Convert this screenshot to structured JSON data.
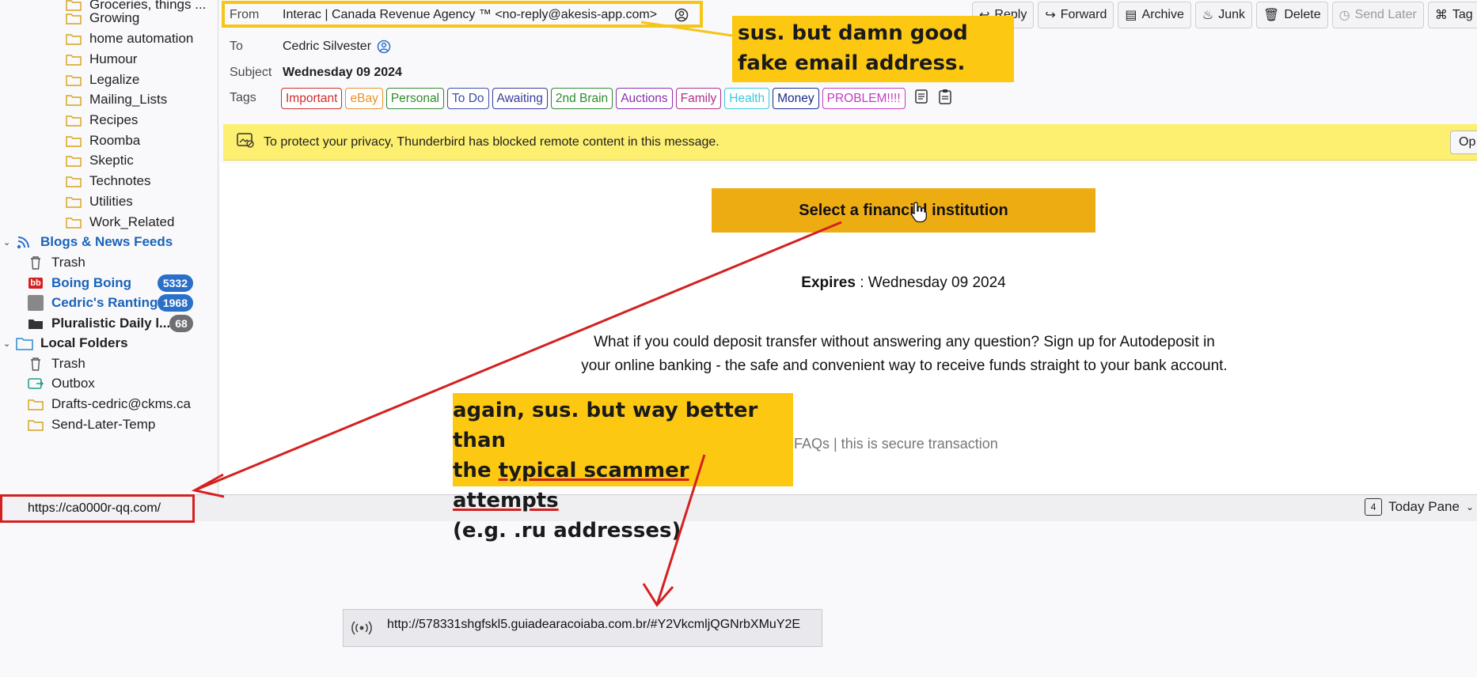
{
  "sidebar": {
    "folders_top": [
      {
        "label": "Groceries, things ..."
      },
      {
        "label": "Growing"
      },
      {
        "label": "home automation"
      },
      {
        "label": "Humour"
      },
      {
        "label": "Legalize"
      },
      {
        "label": "Mailing_Lists"
      },
      {
        "label": "Recipes"
      },
      {
        "label": "Roomba"
      },
      {
        "label": "Skeptic"
      },
      {
        "label": "Technotes"
      },
      {
        "label": "Utilities"
      },
      {
        "label": "Work_Related"
      }
    ],
    "feeds_account": "Blogs & News Feeds",
    "feeds": [
      {
        "label": "Trash"
      },
      {
        "label": "Boing Boing",
        "count": "5332"
      },
      {
        "label": "Cedric's Rantings",
        "count": "1968"
      },
      {
        "label": "Pluralistic Daily l...",
        "count": "68"
      }
    ],
    "local_account": "Local Folders",
    "local": [
      {
        "label": "Trash"
      },
      {
        "label": "Outbox"
      },
      {
        "label": "Drafts-cedric@ckms.ca"
      },
      {
        "label": "Send-Later-Temp"
      }
    ]
  },
  "header": {
    "from_label": "From",
    "from_value": "Interac | Canada Revenue Agency ™ <no-reply@akesis-app.com>",
    "to_label": "To",
    "to_value": "Cedric Silvester",
    "subject_label": "Subject",
    "subject_value": "Wednesday 09 2024",
    "tags_label": "Tags",
    "tags": [
      {
        "label": "Important",
        "color": "#d12b2b"
      },
      {
        "label": "eBay",
        "color": "#e8912b"
      },
      {
        "label": "Personal",
        "color": "#2e8b2e"
      },
      {
        "label": "To Do",
        "color": "#3a4ea8"
      },
      {
        "label": "Awaiting",
        "color": "#3a3a9a"
      },
      {
        "label": "2nd Brain",
        "color": "#2f8a2f"
      },
      {
        "label": "Auctions",
        "color": "#8a2fb0"
      },
      {
        "label": "Family",
        "color": "#b02f8a"
      },
      {
        "label": "Health",
        "color": "#3ac8d8"
      },
      {
        "label": "Money",
        "color": "#1a2a8a"
      },
      {
        "label": "PROBLEM!!!!",
        "color": "#c43ac4"
      }
    ]
  },
  "toolbar": {
    "reply": "Reply",
    "forward": "Forward",
    "archive": "Archive",
    "junk": "Junk",
    "delete": "Delete",
    "send_later": "Send Later",
    "tag": "Tag"
  },
  "privacy_bar": {
    "text": "To protect your privacy, Thunderbird has blocked remote content in this message.",
    "options_label": "Op"
  },
  "message": {
    "cta": "Select a financial institution",
    "expires_label": "Expires",
    "expires_value": " : Wednesday 09 2024",
    "blurb": "What if you could deposit transfer without answering any question? Sign up for Autodeposit in your online banking - the safe and convenient way to receive funds straight to your bank account.",
    "faqs": "FAQs  |  this is secure transaction"
  },
  "status_bar": {
    "url": "https://ca0000r-qq.com/",
    "today_pane": "Today Pane",
    "today_day": "4"
  },
  "second_status": {
    "url": "http://578331shgfskl5.guiadearacoiaba.com.br/#Y2VkcmljQGNrbXMuY2E"
  },
  "annotations": {
    "note1": "sus.  but damn good fake email address.",
    "note2_line1": "again, sus.  but way better than",
    "note2_line2_pre": "the ",
    "note2_line2_underlined": "typical scammer attempts",
    "note2_line3": "(e.g. .ru addresses)"
  },
  "colors": {
    "annotation_yellow": "#fcc812",
    "annotation_red": "#d42020",
    "cta_orange": "#eeac13",
    "privacy_yellow": "#fdef6f",
    "badge_blue": "#2a70c9"
  }
}
